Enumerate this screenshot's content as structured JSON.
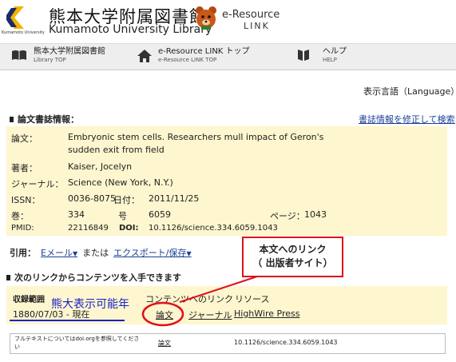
{
  "header": {
    "university_small": "Kumamoto University",
    "title_ja": "熊本大学附属図書館",
    "title_en": "Kumamoto University Library",
    "eresource": "e-Resource",
    "link": "LINK"
  },
  "nav": [
    {
      "title": "熊本大学附属図書館",
      "sub": "Library TOP",
      "icon": "book-icon"
    },
    {
      "title": "e-Resource LINK トップ",
      "sub": "e-Resource LINK TOP",
      "icon": "home-icon"
    },
    {
      "title": "ヘルプ",
      "sub": "HELP",
      "icon": "help-book-icon"
    }
  ],
  "language": "表示言語（Language）",
  "biblio": {
    "heading": "論文書誌情報：",
    "fix_link": "書誌情報を修正して検索",
    "article_label": "論文：",
    "article_line1": "Embryonic stem cells. Researchers mull impact of Geron's",
    "article_line2": "sudden exit from field",
    "author_label": "著者：",
    "author": "Kaiser, Jocelyn",
    "journal_label": "ジャーナル：",
    "journal": "Science (New York, N.Y.)",
    "issn_label": "ISSN：",
    "issn": "0036-8075",
    "date_label": "日付：",
    "date": "2011/11/25",
    "vol_label": "巻：",
    "vol": "334",
    "no_label": "号",
    "no": "6059",
    "page_label": "ページ：",
    "page": "1043",
    "pmid_label": "PMID:",
    "pmid": "22116849",
    "doi_label": "DOI:",
    "doi": "10.1126/science.334.6059.1043"
  },
  "cite": {
    "label": "引用：",
    "email": "Eメール",
    "or": "または",
    "export": "エクスポート/保存"
  },
  "contents": {
    "heading": "次のリンクからコンテンツを入手できます",
    "coverage_label": "収録範囲",
    "coverage_note": "熊大表示可能年",
    "coverage_value": "1880/07/03 - 現在",
    "content_label": "コンテンツへのリンク",
    "resource_label": "リソース",
    "link_article": "論文",
    "link_journal": "ジャーナル",
    "link_resource": "HighWire Press"
  },
  "fulltext": {
    "note": "フルテキストについてはdoi.orgを参照してください",
    "link": "論文",
    "doi": "10.1126/science.334.6059.1043"
  },
  "callout": {
    "line1": "本文へのリンク",
    "line2": "（ 出版者サイト）"
  },
  "colors": {
    "info_bg": "#fdf6cf",
    "link": "#1a3f99",
    "annotation_red": "#e0101a",
    "annotation_blue": "#1a20c8",
    "logo_yellow": "#f0b400",
    "logo_navy": "#1c2a6b"
  }
}
